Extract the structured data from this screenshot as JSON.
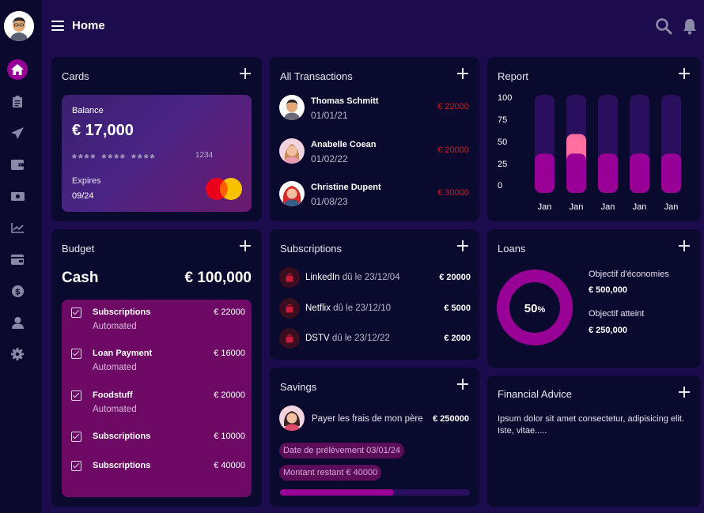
{
  "header": {
    "title": "Home"
  },
  "sidebar": {
    "items": [
      {
        "name": "home-icon"
      },
      {
        "name": "clipboard-icon"
      },
      {
        "name": "send-icon"
      },
      {
        "name": "wallet-icon"
      },
      {
        "name": "money-icon"
      },
      {
        "name": "chart-line-icon"
      },
      {
        "name": "card-icon"
      },
      {
        "name": "dollar-icon"
      },
      {
        "name": "user-icon"
      },
      {
        "name": "gear-icon"
      }
    ]
  },
  "cards": {
    "title": "Cards",
    "balance_label": "Balance",
    "balance": "€ 17,000",
    "masked": "**** **** ****",
    "last4": "1234",
    "expires_label": "Expires",
    "expires": "09/24"
  },
  "transactions": {
    "title": "All Transactions",
    "rows": [
      {
        "name": "Thomas Schmitt",
        "date": "01/01/21",
        "amount": "€ 22000"
      },
      {
        "name": "Anabelle Coean",
        "date": "01/02/22",
        "amount": "€ 20000"
      },
      {
        "name": "Christine Dupent",
        "date": "01/08/23",
        "amount": "€ 30000"
      }
    ]
  },
  "report": {
    "title": "Report",
    "colors": {
      "track": "#2a0f5e",
      "base": "#990096",
      "highlight": "#ff6fa0"
    }
  },
  "chart_data": {
    "type": "bar",
    "categories": [
      "Jan",
      "Jan",
      "Jan",
      "Jan",
      "Jan"
    ],
    "series": [
      {
        "values": [
          40,
          40,
          40,
          40,
          40
        ]
      },
      {
        "values": [
          0,
          20,
          0,
          0,
          0
        ]
      }
    ],
    "yticks": [
      "100",
      "75",
      "50",
      "25",
      "0"
    ],
    "ylim": [
      0,
      100
    ]
  },
  "budget": {
    "title": "Budget",
    "cash_label": "Cash",
    "cash_value": "€ 100,000",
    "items": [
      {
        "name": "Subscriptions",
        "sub": "Automated",
        "amount": "€ 22000"
      },
      {
        "name": "Loan Payment",
        "sub": "Automated",
        "amount": "€ 16000"
      },
      {
        "name": "Foodstuff",
        "sub": "Automated",
        "amount": "€ 20000"
      },
      {
        "name": "Subscriptions",
        "sub": "",
        "amount": "€ 10000"
      },
      {
        "name": "Subscriptions",
        "sub": "",
        "amount": "€ 40000"
      }
    ]
  },
  "subscriptions": {
    "title": "Subscriptions",
    "rows": [
      {
        "name": "LinkedIn",
        "due": "dû le 23/12/04",
        "amount": "€ 20000"
      },
      {
        "name": "Netflix",
        "due": "dû le 23/12/10",
        "amount": "€ 5000"
      },
      {
        "name": "DSTV",
        "due": "dû le 23/12/22",
        "amount": "€ 2000"
      }
    ]
  },
  "savings": {
    "title": "Savings",
    "label": "Payer les frais de mon père",
    "amount": "€ 250000",
    "chip1": "Date de prélèvement 03/01/24",
    "chip2": "Montant restant € 40000",
    "progress": 0.6
  },
  "loans": {
    "title": "Loans",
    "percent": "50",
    "percent_sign": "%",
    "progress": 0.5,
    "goal_label": "Objectif d'économies",
    "goal_value": "€ 500,000",
    "reached_label": "Objectif atteint",
    "reached_value": "€ 250,000"
  },
  "advice": {
    "title": "Financial Advice",
    "text": "Ipsum dolor sit amet consectetur, adipisicing elit. Iste, vitae....."
  }
}
